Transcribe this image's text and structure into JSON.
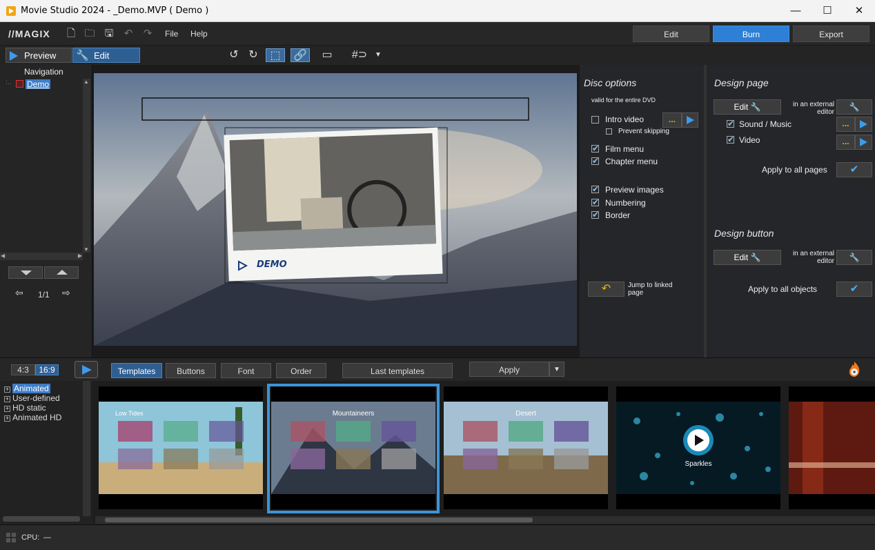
{
  "window": {
    "title": "Movie Studio 2024 - _Demo.MVP ( Demo )",
    "minimize": "—",
    "maximize": "☐",
    "close": "✕"
  },
  "menubar": {
    "logo": "//MAGIX",
    "file": "File",
    "help": "Help",
    "edit_tab": "Edit",
    "burn_tab": "Burn",
    "export_tab": "Export"
  },
  "toolbar": {
    "preview": "Preview",
    "edit": "Edit"
  },
  "nav": {
    "title": "Navigation",
    "tree_item": "Demo",
    "page_counter": "1/1"
  },
  "preview": {
    "menu_title": "DEMO"
  },
  "disc_options": {
    "heading": "Disc options",
    "subheading": "valid for the entire DVD",
    "intro_video": "Intro video",
    "prevent_skipping": "Prevent skipping",
    "film_menu": "Film menu",
    "chapter_menu": "Chapter menu",
    "preview_images": "Preview images",
    "numbering": "Numbering",
    "border": "Border",
    "jump_label": "Jump to linked page",
    "dots": "..."
  },
  "design_page": {
    "heading": "Design page",
    "edit": "Edit",
    "external_editor": "in an external editor",
    "sound_music": "Sound / Music",
    "video": "Video",
    "apply_all": "Apply to all pages"
  },
  "design_button": {
    "heading": "Design button",
    "edit": "Edit",
    "external_editor": "in an external editor",
    "apply_all": "Apply to all objects"
  },
  "bottom": {
    "ratio_43": "4:3",
    "ratio_169": "16:9",
    "templates": "Templates",
    "buttons": "Buttons",
    "font": "Font",
    "order": "Order",
    "last_templates": "Last templates",
    "apply": "Apply"
  },
  "tree": [
    "Animated",
    "User-defined",
    "HD static",
    "Animated HD"
  ],
  "thumbs": [
    {
      "title": "Low Tides"
    },
    {
      "title": "Mountaineers"
    },
    {
      "title": "Desert"
    },
    {
      "title": "Sparkles"
    },
    {
      "title": ""
    }
  ],
  "status": {
    "cpu": "CPU:",
    "cpu_value": "—"
  }
}
